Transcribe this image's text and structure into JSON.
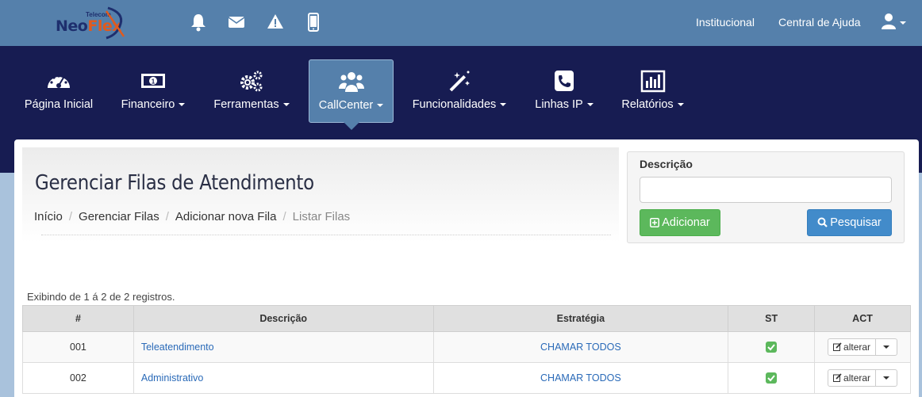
{
  "logo": {
    "brand_main": "Neo",
    "brand_accent": "Flex",
    "small_text": "Telecom"
  },
  "top_icons": [
    "bell-icon",
    "envelope-icon",
    "warning-icon",
    "mobile-icon"
  ],
  "top_links": {
    "institucional": "Institucional",
    "ajuda": "Central de Ajuda"
  },
  "nav": {
    "items": [
      {
        "label": "Página Inicial",
        "icon": "dashboard-icon"
      },
      {
        "label": "Financeiro",
        "icon": "money-icon"
      },
      {
        "label": "Ferramentas",
        "icon": "gears-icon"
      },
      {
        "label": "CallCenter",
        "icon": "users-icon",
        "active": true
      },
      {
        "label": "Funcionalidades",
        "icon": "magic-wand-icon"
      },
      {
        "label": "Linhas IP",
        "icon": "phone-icon"
      },
      {
        "label": "Relatórios",
        "icon": "bar-chart-icon"
      }
    ]
  },
  "page": {
    "title": "Gerenciar Filas de Atendimento",
    "breadcrumb": [
      "Início",
      "Gerenciar Filas",
      "Adicionar nova Fila",
      "Listar Filas"
    ]
  },
  "search": {
    "label": "Descrição",
    "value": "",
    "add_button": "Adicionar",
    "search_button": "Pesquisar"
  },
  "records_text": "Exibindo de 1 á 2 de 2 registros.",
  "table": {
    "headers": [
      "#",
      "Descrição",
      "Estratégia",
      "ST",
      "ACT"
    ],
    "rows": [
      {
        "id": "001",
        "descricao": "Teleatendimento",
        "estrategia": "CHAMAR TODOS",
        "action": "alterar"
      },
      {
        "id": "002",
        "descricao": "Administrativo",
        "estrategia": "CHAMAR TODOS",
        "action": "alterar"
      }
    ]
  },
  "colors": {
    "topbar": "#5580ab",
    "nav": "#171c52",
    "success": "#5cb85c",
    "primary": "#428bca"
  }
}
